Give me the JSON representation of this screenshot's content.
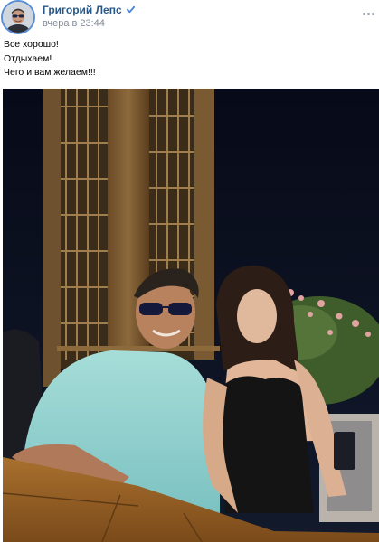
{
  "post": {
    "author_name": "Григорий Лепс",
    "verified_icon": "verified-check-icon",
    "timestamp": "вчера в 23:44",
    "more_icon": "more-dots-icon",
    "text_lines": [
      "Все хорошо!",
      "Отдыхаем!",
      "Чего и вам желаем!!!"
    ],
    "avatar_icon": "author-avatar",
    "photo": "post-photo"
  },
  "colors": {
    "author_link": "#2a5885",
    "meta_text": "#818c99",
    "verified": "#4a86d6",
    "avatar_ring": "#5a8fd8"
  }
}
